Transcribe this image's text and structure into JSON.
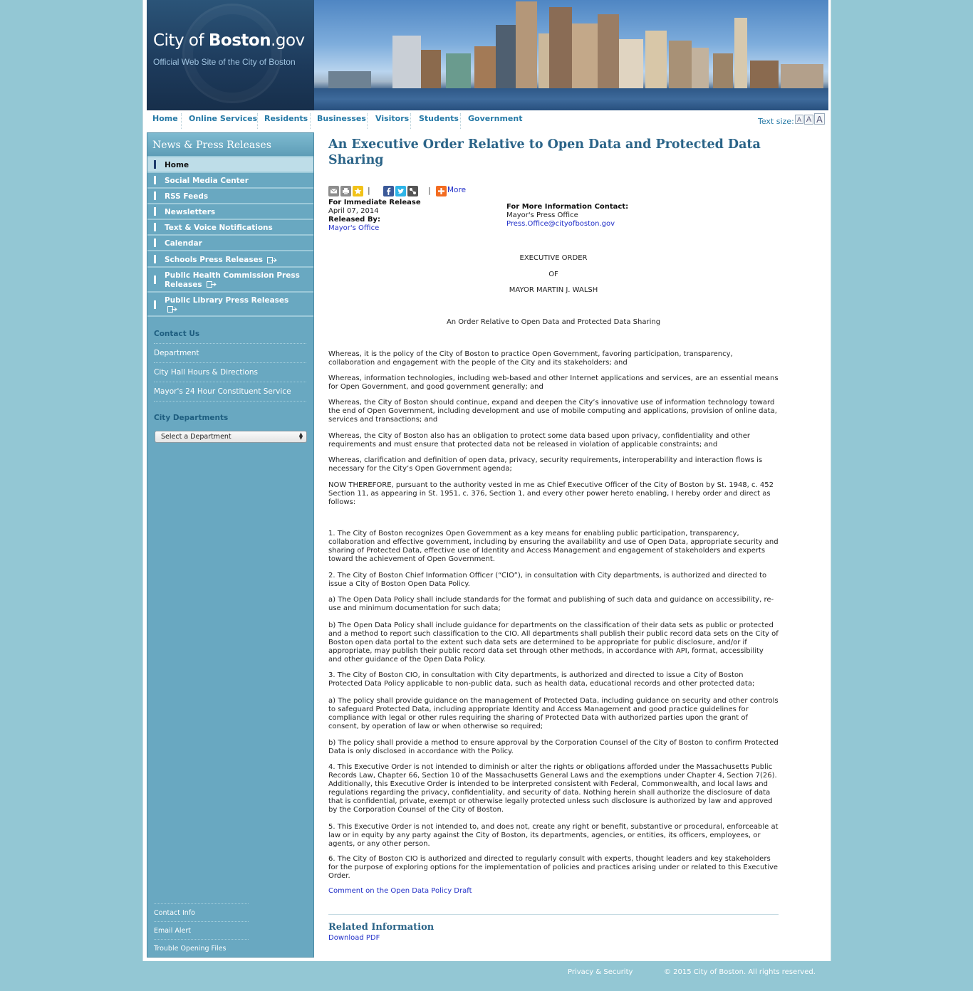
{
  "header": {
    "logo_prefix": "City of ",
    "logo_bold": "Boston",
    "logo_suffix": ".gov",
    "tagline": "Official Web Site of the City of Boston"
  },
  "nav": {
    "items": [
      "Home",
      "Online Services",
      "Residents",
      "Businesses",
      "Visitors",
      "Students",
      "Government"
    ],
    "text_size_label": "Text size:",
    "text_size_buttons": [
      "A",
      "A",
      "A"
    ]
  },
  "sidebar": {
    "title": "News & Press Releases",
    "items": [
      {
        "label": "Home"
      },
      {
        "label": "Social Media Center"
      },
      {
        "label": "RSS Feeds"
      },
      {
        "label": "Newsletters"
      },
      {
        "label": "Text & Voice Notifications"
      },
      {
        "label": "Calendar"
      },
      {
        "label": "Schools Press Releases"
      },
      {
        "label": "Public Health Commission Press",
        "label2": "Releases"
      },
      {
        "label": "Public Library Press Releases"
      }
    ],
    "contact_heading": "Contact Us",
    "contact_links": [
      "Department",
      "City Hall Hours & Directions",
      "Mayor's 24 Hour Constituent Service"
    ],
    "departments_heading": "City Departments",
    "department_select": "Select a Department",
    "footer_links": [
      "Contact Info",
      "Email Alert",
      "Trouble Opening Files"
    ]
  },
  "article": {
    "title": "An Executive Order Relative to Open Data and Protected Data Sharing",
    "share_more": "More",
    "for_release": "For Immediate Release",
    "date": "April 07, 2014",
    "released_by_label": "Released By:",
    "released_by": "Mayor's Office",
    "contact_label": "For More Information Contact:",
    "contact_name": "Mayor's Press Office",
    "contact_email": "Press.Office@cityofboston.gov",
    "heading_lines": [
      "EXECUTIVE ORDER",
      "OF",
      "MAYOR MARTIN J. WALSH"
    ],
    "subheading": "An Order Relative to Open Data and Protected Data Sharing",
    "paragraphs": [
      "Whereas, it is the policy of the City of Boston to practice Open Government, favoring participation, transparency, collaboration and engagement with the people of the City and its stakeholders; and",
      "Whereas, information technologies, including web-based and other Internet applications and services, are an essential means for Open Government, and good government generally; and",
      "Whereas, the City of Boston should continue, expand and deepen the City’s innovative use of information technology toward the end of Open Government, including development and use of mobile computing and applications, provision of online data, services and transactions; and",
      "Whereas, the City of Boston also has an obligation to protect some data based upon privacy, confidentiality and other requirements and must ensure that protected data not be released in violation of applicable constraints; and",
      "Whereas, clarification and definition of open data, privacy, security requirements, interoperability and interaction flows is necessary for the City’s Open Government agenda;",
      "NOW THEREFORE, pursuant to the authority vested in me as Chief Executive Officer of the City of Boston by St. 1948, c. 452 Section 11, as appearing in St. 1951, c. 376, Section 1, and every other power hereto enabling, I hereby order and direct as follows:",
      "1. The City of Boston recognizes Open Government as a key means for enabling public participation, transparency, collaboration and effective government, including by ensuring the availability and use of Open Data, appropriate security and sharing of Protected Data, effective use of Identity and Access Management and engagement of stakeholders and experts toward the achievement of Open Government.",
      "2. The City of Boston Chief Information Officer (“CIO”), in consultation with City departments, is authorized and directed to issue a City of Boston Open Data Policy.",
      "a) The Open Data Policy shall include standards for the format and publishing of such data and guidance on accessibility, re-use and minimum documentation for such data;",
      "b) The Open Data Policy shall include guidance for departments on the classification of their data sets as public or protected and a method to report such classification to the CIO.  All departments shall publish their public record data sets on the City of Boston open data portal to the extent such data sets are determined to be appropriate for public disclosure, and/or if appropriate, may publish their public record data set through other methods, in accordance with API, format, accessibility and other guidance of the Open Data Policy.",
      "3. The City of Boston CIO, in consultation with City departments, is authorized and directed to issue a City of Boston Protected Data Policy applicable to non-public data, such as health data, educational records and other protected data;",
      "a) The policy shall provide guidance on the management of Protected Data, including guidance on security and other controls to safeguard Protected Data, including appropriate Identity and Access Management and good practice guidelines for compliance with legal or other rules requiring the sharing of Protected Data with authorized parties upon the grant of consent, by operation of law or when otherwise so required;",
      "b) The policy shall provide a method to ensure approval by the Corporation Counsel of the City of Boston to confirm Protected Data is only disclosed in accordance with the Policy.",
      "4. This Executive Order is not intended to diminish or alter the rights or obligations afforded under the Massachusetts Public Records Law, Chapter 66, Section 10 of the Massachusetts General Laws and the exemptions under Chapter 4, Section 7(26).  Additionally, this Executive Order is intended to be interpreted consistent with Federal, Commonwealth, and local laws and regulations regarding the privacy, confidentiality, and security of data.  Nothing herein shall authorize the disclosure of data that is confidential, private, exempt or otherwise legally protected unless such disclosure is authorized by law and approved by the Corporation Counsel of the City of Boston.",
      "5. This Executive Order is not intended to, and does not, create any right or benefit, substantive or procedural, enforceable at law or in equity by any party against the City of Boston, its departments, agencies, or entities, its officers, employees, or agents, or any other person.",
      "6. The City of Boston CIO is authorized and directed to regularly consult with experts, thought leaders and key stakeholders for the purpose of exploring options for the implementation of policies and practices arising under or related to this Executive Order."
    ],
    "comment_link": "Comment on the Open Data Policy Draft",
    "related_title": "Related Information",
    "related_link": "Download PDF"
  },
  "footer": {
    "privacy": "Privacy & Security",
    "copyright": "© 2015 City of Boston. All rights reserved."
  },
  "colors": {
    "page_bg": "#93c7d4",
    "sidebar_bg": "#69a8c1",
    "title_blue": "#2b6488",
    "nav_blue": "#2579a6",
    "link_blue": "#2230c8"
  }
}
